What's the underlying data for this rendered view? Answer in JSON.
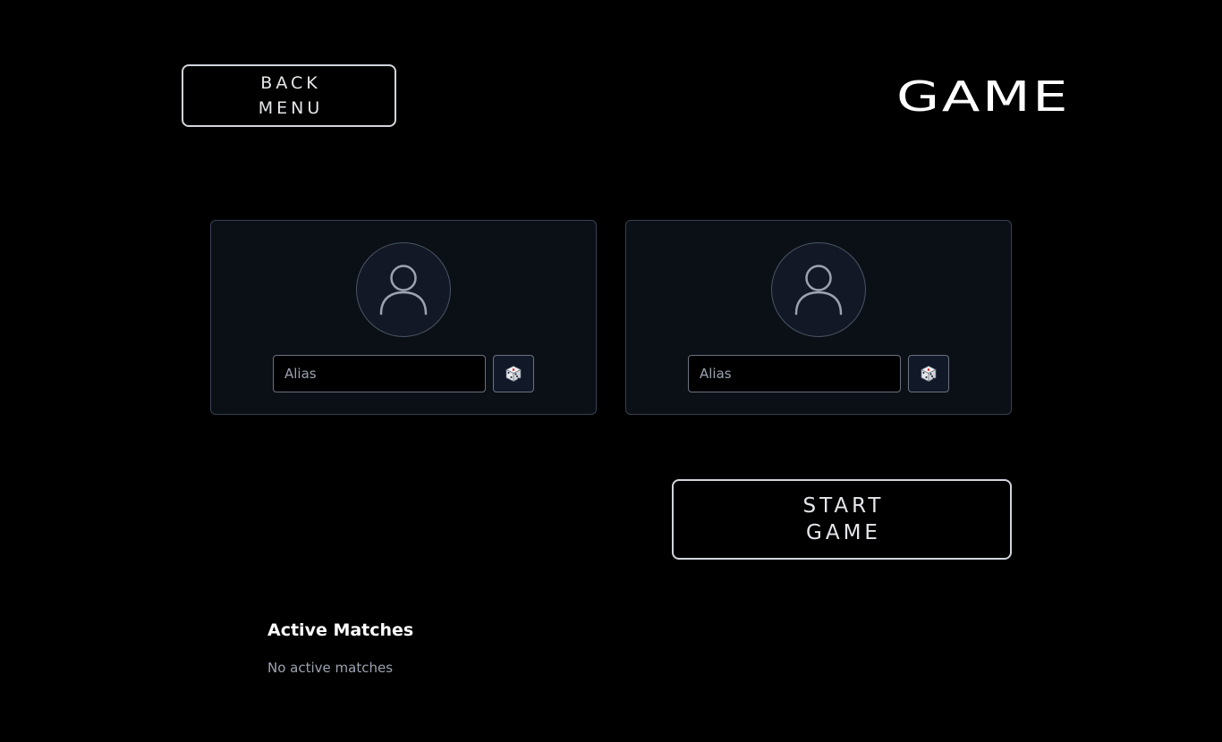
{
  "header": {
    "back_line1": "BACK",
    "back_line2": "MENU",
    "title": "GAME"
  },
  "players": [
    {
      "alias_placeholder": "Alias",
      "avatar_icon": "user-icon",
      "random_icon": "dice-icon"
    },
    {
      "alias_placeholder": "Alias",
      "avatar_icon": "user-icon",
      "random_icon": "dice-icon"
    }
  ],
  "start": {
    "line1": "START",
    "line2": "GAME"
  },
  "active_matches": {
    "title": "Active Matches",
    "empty_text": "No active matches"
  },
  "colors": {
    "background": "#000000",
    "card": "#0b0f16",
    "border": "#d1d5db",
    "muted_text": "#9ca3af"
  }
}
